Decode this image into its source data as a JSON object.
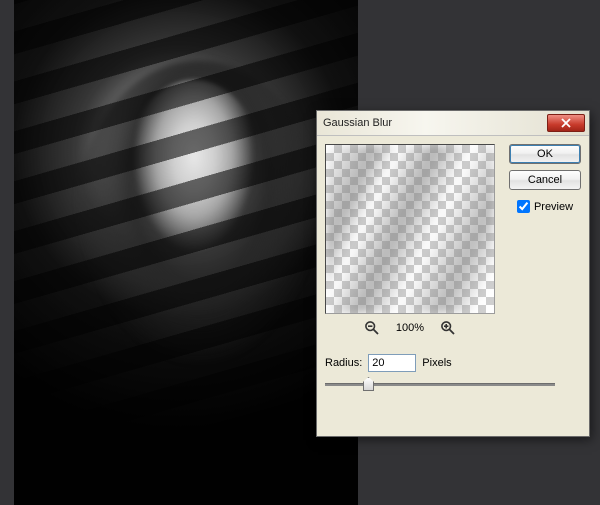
{
  "dialog": {
    "title": "Gaussian Blur",
    "ok_label": "OK",
    "cancel_label": "Cancel",
    "preview_label": "Preview",
    "preview_checked": true,
    "zoom_level": "100%",
    "radius_label": "Radius:",
    "radius_value": "20",
    "radius_unit": "Pixels"
  }
}
